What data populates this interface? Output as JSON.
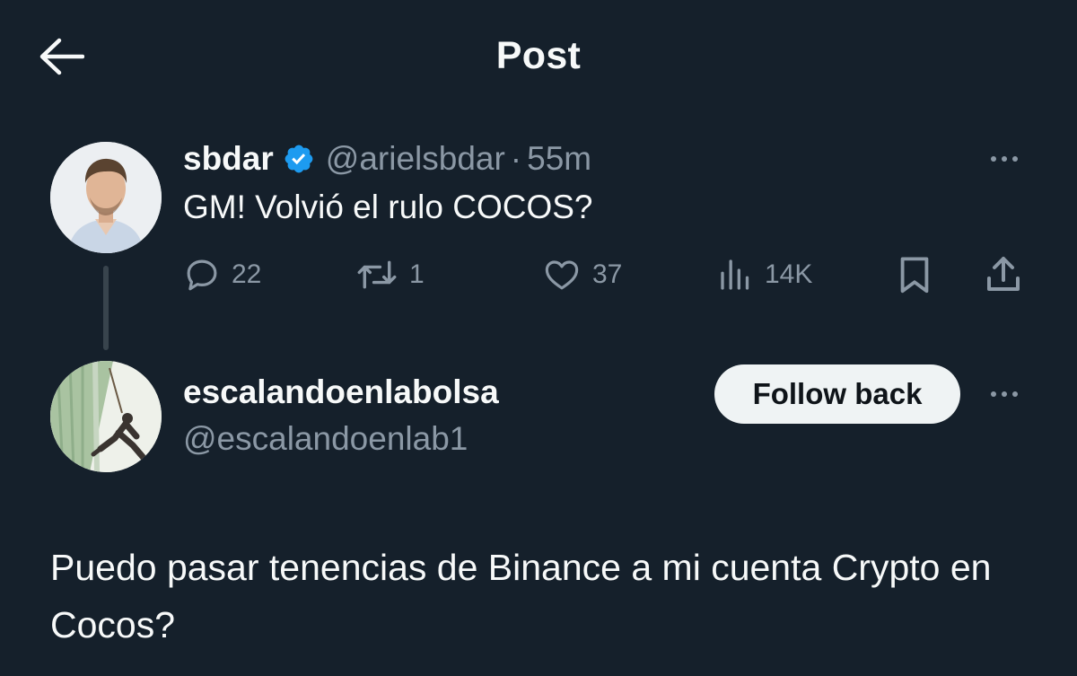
{
  "header": {
    "title": "Post",
    "back_icon": "arrow-left-icon"
  },
  "tweet": {
    "display_name": "sbdar",
    "verified": true,
    "verified_color": "#1d9bf0",
    "handle": "@arielsbdar",
    "separator": "·",
    "time": "55m",
    "text": "GM! Volvió el rulo COCOS?",
    "actions": {
      "replies": "22",
      "reposts": "1",
      "likes": "37",
      "views": "14K"
    }
  },
  "reply": {
    "display_name": "escalandoenlabolsa",
    "handle": "@escalandoenlab1",
    "follow_label": "Follow back",
    "text": "Puedo pasar tenencias de Binance a mi cuenta Crypto en Cocos?"
  },
  "colors": {
    "background": "#15202b",
    "secondary_text": "#8b98a5",
    "primary_text": "#f7f9f9"
  }
}
